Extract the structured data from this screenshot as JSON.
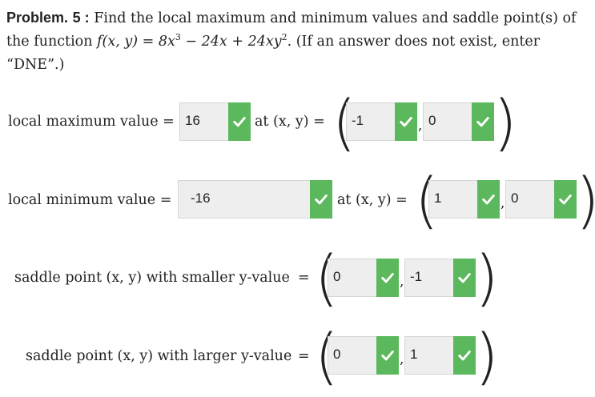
{
  "problem": {
    "label": "Problem.",
    "number": "5 :",
    "text_part1": "Find the local maximum and minimum values and saddle point(s) of",
    "text_part2_prefix": "the function ",
    "function_expr_lhs": "f(x, y)",
    "function_expr_eq": " = 8x",
    "exp3": "3",
    "function_expr_mid": " − 24x + 24xy",
    "exp2": "2",
    "text_part2_suffix": ". (If an answer does not exist, enter",
    "text_part3": "“DNE”.)"
  },
  "rows": {
    "max": {
      "label": "local maximum value =",
      "value": "16",
      "at_label": "at (x, y) =",
      "x": "-1",
      "y": "0"
    },
    "min": {
      "label": "local minimum value =",
      "value": "-16",
      "at_label": "at (x, y) =",
      "x": "1",
      "y": "0"
    },
    "saddle_small": {
      "label": "saddle point (x, y) with smaller y-value",
      "eq": "=",
      "x": "0",
      "y": "-1"
    },
    "saddle_large": {
      "label": "saddle point (x, y) with larger y-value",
      "eq": "=",
      "x": "0",
      "y": "1"
    }
  },
  "punctuation": {
    "open_paren": "(",
    "close_paren": ")",
    "comma": ","
  },
  "colors": {
    "correct_green": "#5cb85c",
    "field_bg": "#eeeeee"
  },
  "icons": {
    "correct": "check-icon"
  }
}
